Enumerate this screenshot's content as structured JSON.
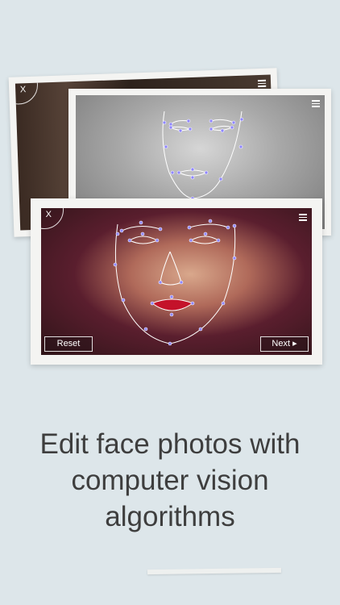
{
  "tagline": {
    "line1": "Edit face photos with",
    "line2": "computer vision",
    "line3": "algorithms"
  },
  "card_front": {
    "close_glyph": "X",
    "reset_label": "Reset",
    "next_label": "Next ▸",
    "menu_icon": "menu-icon"
  },
  "card_middle": {
    "menu_icon": "menu-icon"
  },
  "card_back": {
    "close_glyph": "X",
    "menu_icon": "menu-icon"
  },
  "colors": {
    "background": "#dde6ea",
    "landmark": "#8f86ff",
    "text": "#3e3e3e"
  }
}
